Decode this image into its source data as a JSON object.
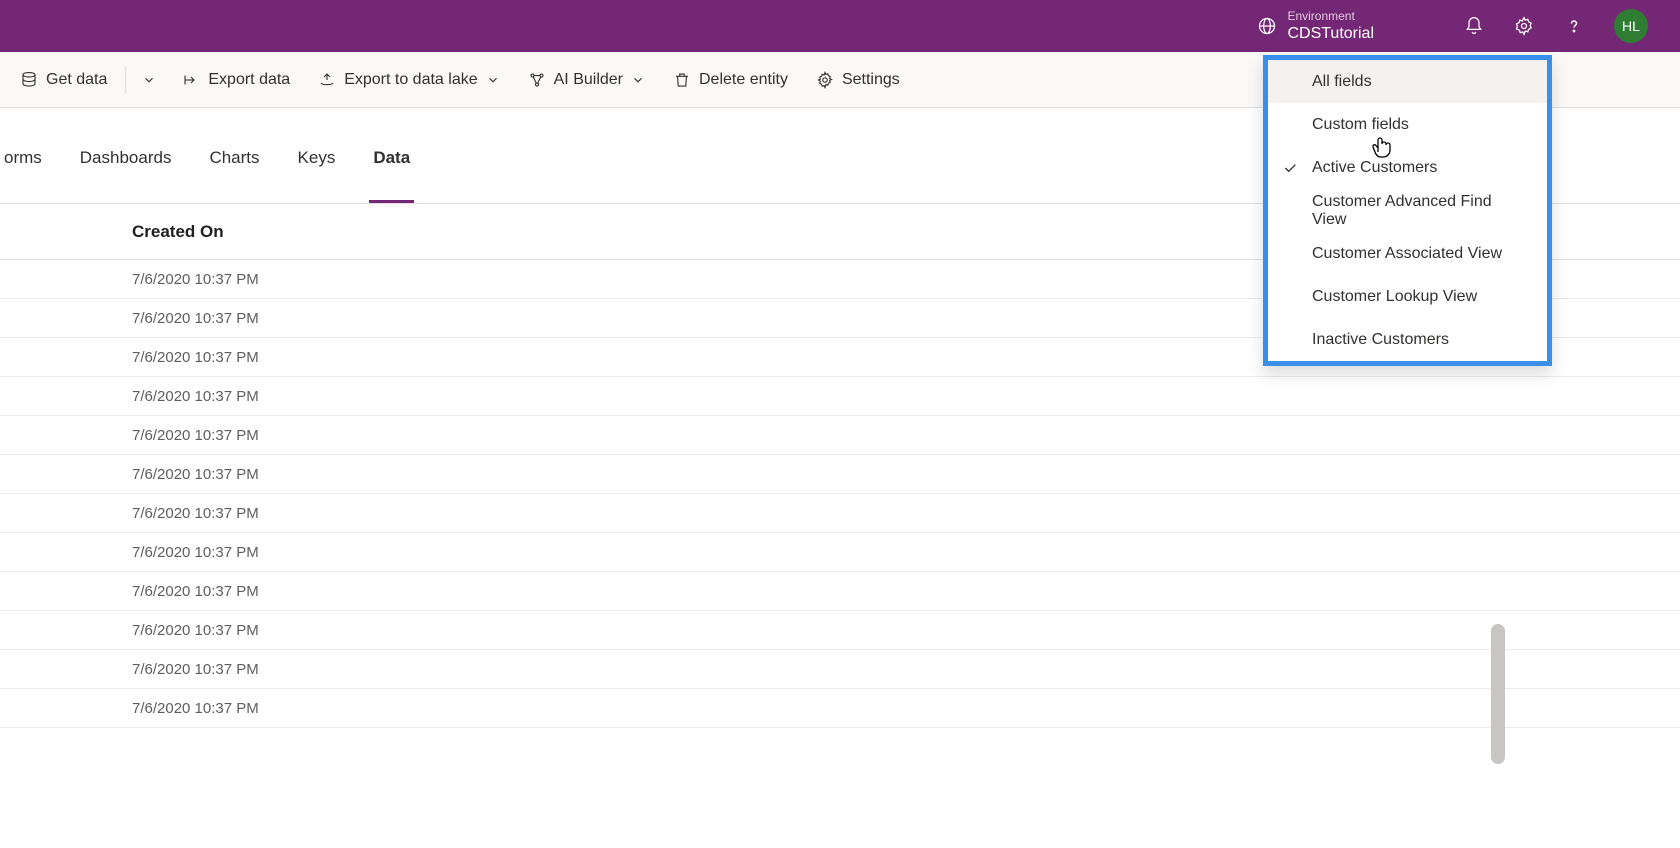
{
  "header": {
    "environment_label": "Environment",
    "environment_name": "CDSTutorial",
    "avatar_initials": "HL"
  },
  "command_bar": {
    "get_data": "Get data",
    "export_data": "Export data",
    "export_lake": "Export to data lake",
    "ai_builder": "AI Builder",
    "delete_entity": "Delete entity",
    "settings": "Settings",
    "view_selector_label": "Active Customers"
  },
  "tabs": {
    "items": [
      {
        "label": "orms"
      },
      {
        "label": "Dashboards"
      },
      {
        "label": "Charts"
      },
      {
        "label": "Keys"
      },
      {
        "label": "Data"
      }
    ],
    "active_index": 4
  },
  "table": {
    "column_header": "Created On",
    "rows": [
      "7/6/2020 10:37 PM",
      "7/6/2020 10:37 PM",
      "7/6/2020 10:37 PM",
      "7/6/2020 10:37 PM",
      "7/6/2020 10:37 PM",
      "7/6/2020 10:37 PM",
      "7/6/2020 10:37 PM",
      "7/6/2020 10:37 PM",
      "7/6/2020 10:37 PM",
      "7/6/2020 10:37 PM",
      "7/6/2020 10:37 PM",
      "7/6/2020 10:37 PM"
    ]
  },
  "dropdown": {
    "items": [
      {
        "label": "All fields",
        "checked": false,
        "hovered": true
      },
      {
        "label": "Custom fields",
        "checked": false,
        "hovered": false
      },
      {
        "label": "Active Customers",
        "checked": true,
        "hovered": false
      },
      {
        "label": "Customer Advanced Find View",
        "checked": false,
        "hovered": false
      },
      {
        "label": "Customer Associated View",
        "checked": false,
        "hovered": false
      },
      {
        "label": "Customer Lookup View",
        "checked": false,
        "hovered": false
      },
      {
        "label": "Inactive Customers",
        "checked": false,
        "hovered": false
      }
    ]
  }
}
